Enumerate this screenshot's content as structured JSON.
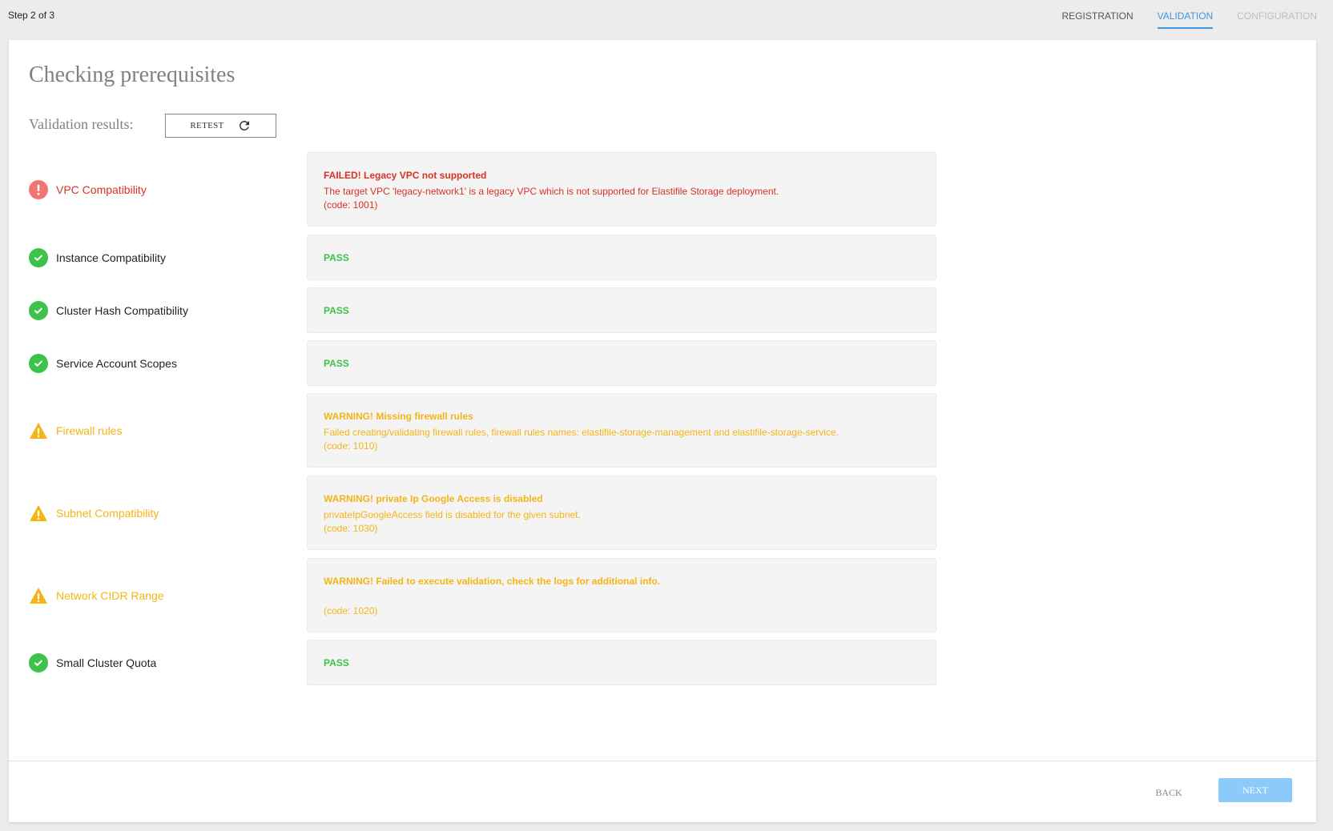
{
  "header": {
    "step_label": "Step 2 of 3",
    "tabs": [
      {
        "label": "REGISTRATION",
        "state": "done"
      },
      {
        "label": "VALIDATION",
        "state": "active"
      },
      {
        "label": "CONFIGURATION",
        "state": "pending"
      }
    ]
  },
  "main": {
    "title": "Checking prerequisites",
    "results_label": "Validation results:",
    "retest_label": "RETEST",
    "retest_icon": "refresh-icon"
  },
  "checks": [
    {
      "name": "VPC Compatibility",
      "status": "fail",
      "icon": "error-icon",
      "title": "FAILED!  Legacy VPC not supported",
      "message": "The target VPC 'legacy-network1' is a legacy VPC which is not supported for Elastifile Storage deployment.",
      "code": "(code: 1001)"
    },
    {
      "name": "Instance Compatibility",
      "status": "pass",
      "icon": "check-icon",
      "title": "PASS"
    },
    {
      "name": "Cluster Hash Compatibility",
      "status": "pass",
      "icon": "check-icon",
      "title": "PASS"
    },
    {
      "name": "Service Account Scopes",
      "status": "pass",
      "icon": "check-icon",
      "title": "PASS"
    },
    {
      "name": "Firewall rules",
      "status": "warn",
      "icon": "warning-icon",
      "title": "WARNING!  Missing firewall rules",
      "message": "Failed creating/validating firewall rules, firewall rules names: elastifile-storage-management and elastifile-storage-service.",
      "code": "(code: 1010)"
    },
    {
      "name": "Subnet Compatibility",
      "status": "warn",
      "icon": "warning-icon",
      "title": "WARNING!  private Ip Google Access is disabled",
      "message": "privateIpGoogleAccess field is disabled for the given subnet.",
      "code": "(code: 1030)"
    },
    {
      "name": "Network CIDR Range",
      "status": "warn",
      "icon": "warning-icon",
      "title": "WARNING!  Failed to execute validation, check the logs for additional info.",
      "message": "",
      "code": "(code: 1020)"
    },
    {
      "name": "Small Cluster Quota",
      "status": "pass",
      "icon": "check-icon",
      "title": "PASS"
    }
  ],
  "footer": {
    "back_label": "BACK",
    "next_label": "NEXT"
  },
  "colors": {
    "accent": "#3c97e6",
    "pass": "#3dc24a",
    "fail": "#d93124",
    "fail_icon": "#f47373",
    "warn": "#f5b417",
    "next_disabled": "#8ccafa"
  }
}
